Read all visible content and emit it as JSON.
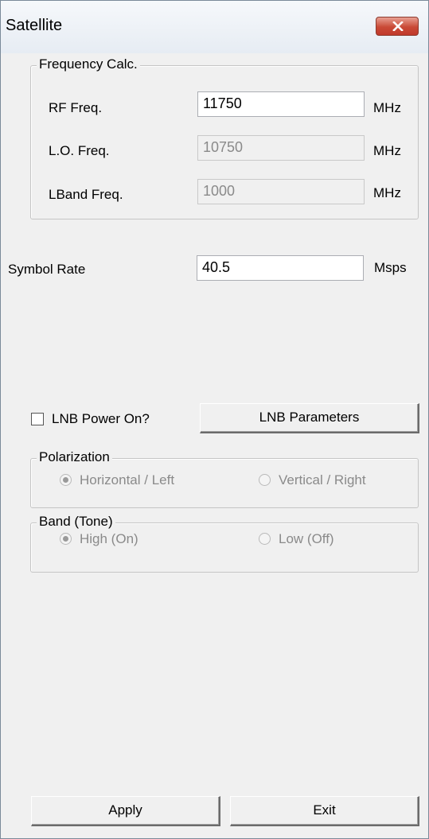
{
  "window": {
    "title": "Satellite"
  },
  "frequency_group": {
    "legend": "Frequency Calc.",
    "rows": [
      {
        "label": "RF Freq.",
        "value": "11750",
        "unit": "MHz",
        "enabled": true
      },
      {
        "label": "L.O. Freq.",
        "value": "10750",
        "unit": "MHz",
        "enabled": false
      },
      {
        "label": "LBand Freq.",
        "value": "1000",
        "unit": "MHz",
        "enabled": false
      }
    ]
  },
  "symbol_rate": {
    "label": "Symbol Rate",
    "value": "40.5",
    "unit": "Msps"
  },
  "lnb": {
    "checkbox_label": "LNB Power On?",
    "checked": false,
    "params_button": "LNB Parameters"
  },
  "polarization": {
    "legend": "Polarization",
    "options": [
      {
        "label": "Horizontal / Left",
        "selected": true
      },
      {
        "label": "Vertical / Right",
        "selected": false
      }
    ]
  },
  "band": {
    "legend": "Band (Tone)",
    "options": [
      {
        "label": "High (On)",
        "selected": true
      },
      {
        "label": "Low (Off)",
        "selected": false
      }
    ]
  },
  "footer": {
    "apply_label": "Apply",
    "exit_label": "Exit"
  },
  "colors": {
    "close_button": "#c94a36",
    "window_bg": "#f0f0f0"
  }
}
